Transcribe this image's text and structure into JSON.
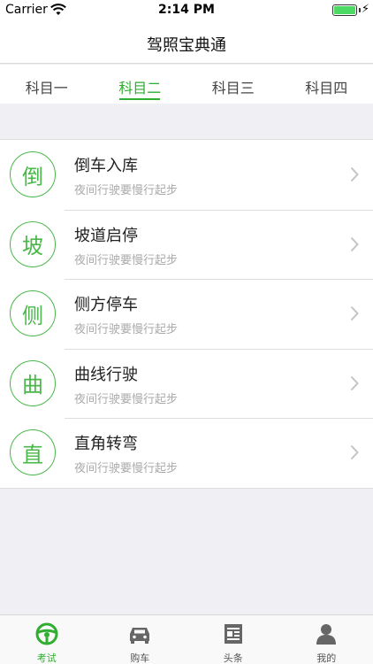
{
  "status_bar": {
    "carrier": "Carrier",
    "time": "2:14 PM",
    "charging_symbol": "⚡"
  },
  "nav": {
    "title": "驾照宝典通"
  },
  "subject_tabs": [
    {
      "label": "科目一",
      "active": false
    },
    {
      "label": "科目二",
      "active": true
    },
    {
      "label": "科目三",
      "active": false
    },
    {
      "label": "科目四",
      "active": false
    }
  ],
  "items": [
    {
      "icon_char": "倒",
      "title": "倒车入库",
      "subtitle": "夜间行驶要慢行起步"
    },
    {
      "icon_char": "坡",
      "title": "坡道启停",
      "subtitle": "夜间行驶要慢行起步"
    },
    {
      "icon_char": "侧",
      "title": "侧方停车",
      "subtitle": "夜间行驶要慢行起步"
    },
    {
      "icon_char": "曲",
      "title": "曲线行驶",
      "subtitle": "夜间行驶要慢行起步"
    },
    {
      "icon_char": "直",
      "title": "直角转弯",
      "subtitle": "夜间行驶要慢行起步"
    }
  ],
  "bottom_tabs": [
    {
      "label": "考试",
      "icon": "steering-wheel-icon",
      "active": true
    },
    {
      "label": "购车",
      "icon": "car-icon",
      "active": false
    },
    {
      "label": "头条",
      "icon": "news-icon",
      "active": false
    },
    {
      "label": "我的",
      "icon": "person-icon",
      "active": false
    }
  ],
  "colors": {
    "accent": "#2fae2f",
    "icon_green": "#49b749",
    "background": "#efeff4",
    "battery": "#4cd964"
  }
}
